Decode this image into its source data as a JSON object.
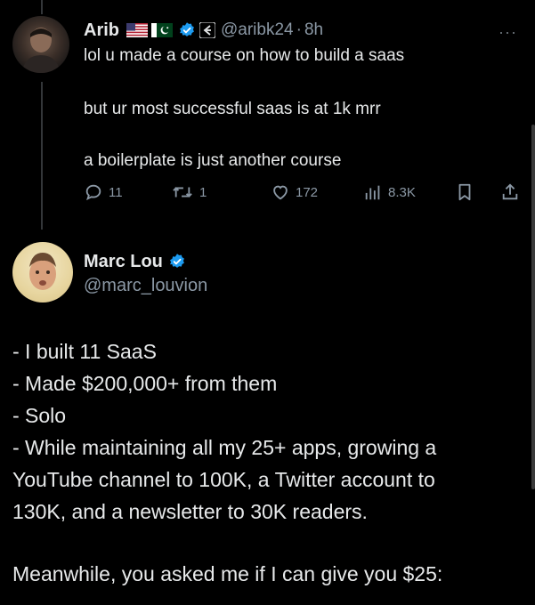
{
  "reply": {
    "author_name": "Arib",
    "handle": "@aribk24",
    "separator": "·",
    "time": "8h",
    "flags": [
      "us-flag-icon",
      "pakistan-flag-icon"
    ],
    "badges": [
      "verified-icon",
      "affiliate-badge-icon"
    ],
    "lines": [
      "lol u made a course on how to build a saas",
      "but ur most successful saas is at 1k mrr",
      "a boilerplate is just another course"
    ],
    "actions": {
      "replies": "11",
      "reposts": "1",
      "likes": "172",
      "views": "8.3K"
    }
  },
  "main_tweet": {
    "author_name": "Marc Lou",
    "handle": "@marc_louvion",
    "lines": [
      "- I built 11 SaaS",
      "- Made $200,000+ from them",
      "- Solo",
      "- While maintaining all my 25+ apps, growing a",
      "YouTube channel to 100K, a Twitter account to",
      "130K, and a newsletter to 30K readers.",
      "",
      "Meanwhile, you asked me if I can give you $25:"
    ]
  },
  "colors": {
    "background": "#000000",
    "text": "#e7e9ea",
    "muted": "#8b98a5",
    "verified": "#1d9bf0"
  }
}
